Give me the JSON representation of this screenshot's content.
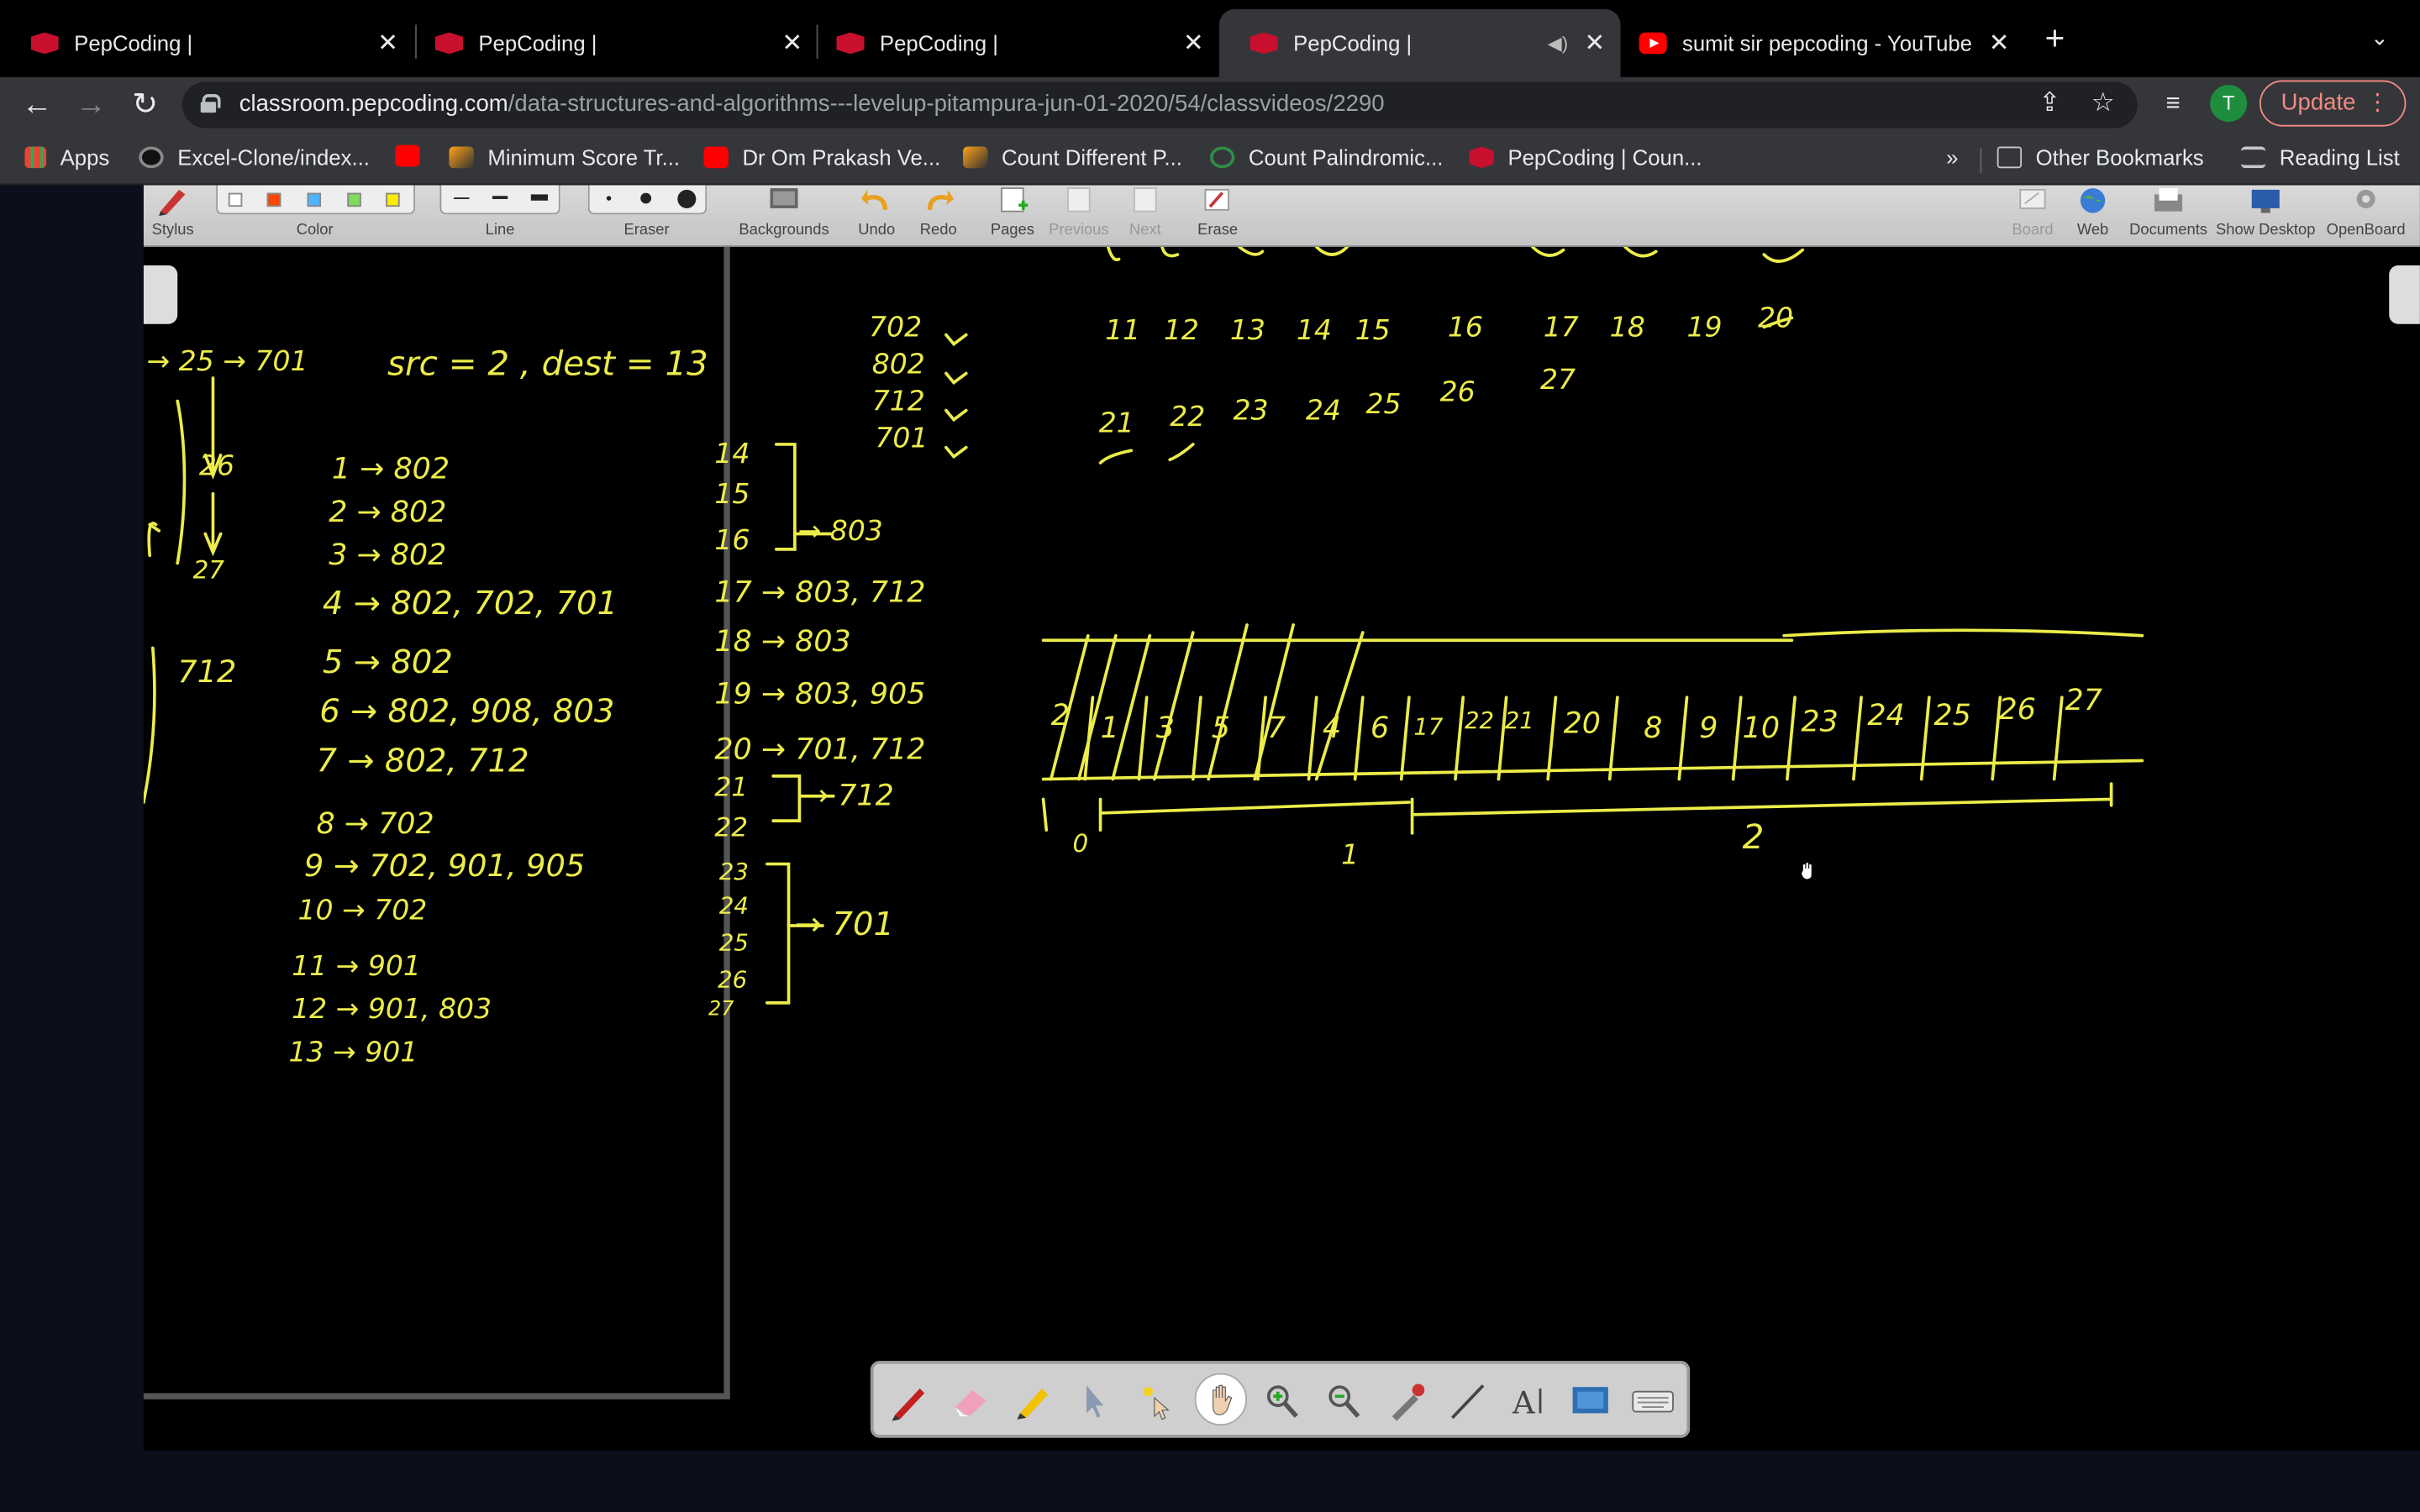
{
  "tabs": [
    {
      "title": "PepCoding |",
      "icon": "pepcoding-icon"
    },
    {
      "title": "PepCoding |",
      "icon": "pepcoding-icon"
    },
    {
      "title": "PepCoding |",
      "icon": "pepcoding-icon"
    },
    {
      "title": "PepCoding |",
      "icon": "pepcoding-icon",
      "active": true
    },
    {
      "title": "sumit sir pepcoding - YouTube",
      "icon": "youtube-icon"
    }
  ],
  "address": {
    "domain": "classroom.pepcoding.com",
    "path": "/data-structures-and-algorithms---levelup-pitampura-jun-01-2020/54/classvideos/2290"
  },
  "profile_initial": "T",
  "update_label": "Update",
  "bookmarks": [
    {
      "label": "Apps",
      "icon": "apps-icon"
    },
    {
      "label": "Excel-Clone/index...",
      "icon": "github-icon"
    },
    {
      "label": "",
      "icon": "youtube-icon"
    },
    {
      "label": "Minimum Score Tr...",
      "icon": "leetcode-icon"
    },
    {
      "label": "Dr Om Prakash Ve...",
      "icon": "youtube-icon"
    },
    {
      "label": "Count Different P...",
      "icon": "leetcode-icon"
    },
    {
      "label": "Count Palindromic...",
      "icon": "gfg-icon"
    },
    {
      "label": "PepCoding | Coun...",
      "icon": "pepcoding-icon"
    }
  ],
  "bookmarks_overflow": "»",
  "other_bookmarks": "Other Bookmarks",
  "reading_list": "Reading List",
  "openboard": {
    "tools_left": [
      "Stylus",
      "Color",
      "Line",
      "Eraser",
      "Backgrounds",
      "Undo",
      "Redo",
      "Pages",
      "Previous",
      "Next",
      "Erase"
    ],
    "tools_right": [
      "Board",
      "Web",
      "Documents",
      "Show Desktop",
      "OpenBoard"
    ],
    "colors": [
      "#ffffff",
      "#ff4500",
      "#4fb3ff",
      "#7ddc5a",
      "#ffeb00"
    ],
    "ink_color": "#ecec4a"
  },
  "whiteboard": {
    "left_panel": {
      "header": "src = 2 , dest = 13",
      "chain_top": "→ 25 → 701",
      "chain_26": "26",
      "chain_27": "27",
      "label_712": "712",
      "stops": [
        "1 → 802",
        "2 → 802",
        "3 → 802",
        "4 → 802, 702, 701",
        "5 → 802",
        "6 → 802, 908, 803",
        "7 → 802, 712",
        "8 → 702",
        "9 → 702, 901, 905",
        "10 → 702",
        "11 → 901",
        "12 → 901, 803",
        "13 → 901"
      ]
    },
    "middle_panel": {
      "buses": [
        "702",
        "802",
        "712",
        "701"
      ],
      "group_14_16": [
        "14",
        "15",
        "16"
      ],
      "group_14_16_bus": "→ 803",
      "stops": [
        "17 → 803, 712",
        "18 → 803",
        "19 → 803, 905",
        "20 → 701, 712"
      ],
      "group_21_22": [
        "21",
        "22"
      ],
      "group_21_22_bus": "→ 712",
      "group_23_27": [
        "23",
        "24",
        "25",
        "26",
        "27"
      ],
      "group_23_27_bus": "→ 701"
    },
    "right_panel": {
      "row1": [
        "11",
        "12",
        "13",
        "14",
        "15",
        "16",
        "17",
        "18",
        "19",
        "20"
      ],
      "row2": [
        "21",
        "22",
        "23",
        "24",
        "25",
        "26",
        "27"
      ],
      "queue": [
        "2",
        "1",
        "3",
        "5",
        "7",
        "4",
        "6",
        "17",
        "22",
        "21",
        "20",
        "8",
        "9",
        "10",
        "23",
        "24",
        "25",
        "26",
        "27"
      ],
      "levels": [
        "0",
        "1",
        "2"
      ]
    }
  },
  "dock_tools": [
    "pen-icon",
    "eraser-icon",
    "marker-icon",
    "pointer-icon",
    "laser-icon",
    "hand-icon",
    "zoom-in-icon",
    "zoom-out-icon",
    "pipette-icon",
    "line-icon",
    "text-icon",
    "capture-icon",
    "keyboard-icon"
  ]
}
